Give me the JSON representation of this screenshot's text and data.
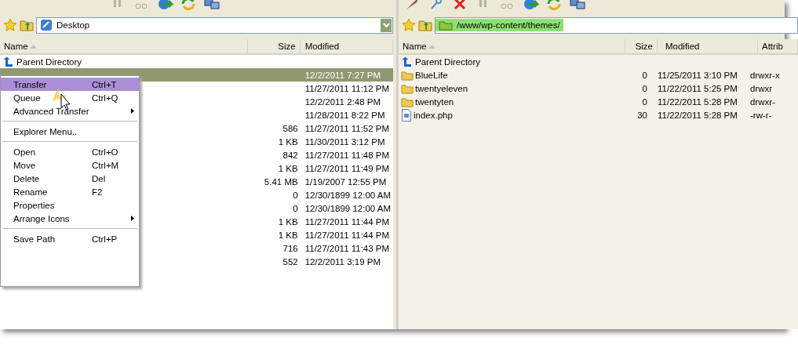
{
  "left_pane": {
    "path": "Desktop",
    "columns": [
      {
        "label": "Name",
        "sorted": true
      },
      {
        "label": "Size",
        "sorted": false
      },
      {
        "label": "Modified",
        "sorted": false
      }
    ],
    "rows": [
      {
        "kind": "parent",
        "name": "Parent Directory",
        "selected": false
      },
      {
        "kind": "hidden",
        "modified": "12/2/2011 7:27 PM",
        "selected": true
      },
      {
        "kind": "hidden",
        "modified": "11/27/2011 11:12 PM",
        "selected": false
      },
      {
        "kind": "hidden",
        "modified": "12/2/2011 2:48 PM",
        "selected": false
      },
      {
        "kind": "hidden",
        "modified": "11/28/2011 8:22 PM",
        "selected": false
      },
      {
        "kind": "hidden",
        "size": "586",
        "modified": "11/27/2011 11:52 PM",
        "selected": false
      },
      {
        "kind": "hidden",
        "size": "1 KB",
        "modified": "11/30/2011 3:12 PM",
        "selected": false
      },
      {
        "kind": "hidden",
        "size": "842",
        "modified": "11/27/2011 11:48 PM",
        "selected": false
      },
      {
        "kind": "hidden",
        "size": "1 KB",
        "modified": "11/27/2011 11:49 PM",
        "selected": false
      },
      {
        "kind": "hidden",
        "size": "5.41 MB",
        "modified": "1/19/2007 12:55 PM",
        "selected": false
      },
      {
        "kind": "hidden",
        "size": "0",
        "modified": "12/30/1899 12:00 AM",
        "selected": false
      },
      {
        "kind": "hidden",
        "size": "0",
        "modified": "12/30/1899 12:00 AM",
        "selected": false
      },
      {
        "kind": "hidden",
        "size": "1 KB",
        "modified": "11/27/2011 11:44 PM",
        "selected": false
      },
      {
        "kind": "hidden",
        "size": "1 KB",
        "modified": "11/27/2011 11:44 PM",
        "selected": false
      },
      {
        "kind": "hidden",
        "size": "716",
        "modified": "11/27/2011 11:43 PM",
        "selected": false
      },
      {
        "kind": "hidden",
        "size": "552",
        "modified": "12/2/2011 3:19 PM",
        "selected": false
      }
    ]
  },
  "context_menu": {
    "items": [
      {
        "kind": "item",
        "label": "Transfer",
        "shortcut": "Ctrl+T",
        "selected": true
      },
      {
        "kind": "item",
        "label": "Queue",
        "shortcut": "Ctrl+Q",
        "selected": false
      },
      {
        "kind": "submenu",
        "label": "Advanced Transfer",
        "selected": false
      },
      {
        "kind": "separator"
      },
      {
        "kind": "item",
        "label": "Explorer Menu..",
        "selected": false
      },
      {
        "kind": "separator"
      },
      {
        "kind": "item",
        "label": "Open",
        "shortcut": "Ctrl+O",
        "selected": false
      },
      {
        "kind": "item",
        "label": "Move",
        "shortcut": "Ctrl+M",
        "selected": false
      },
      {
        "kind": "item",
        "label": "Delete",
        "shortcut": "Del",
        "selected": false
      },
      {
        "kind": "item",
        "label": "Rename",
        "shortcut": "F2",
        "selected": false
      },
      {
        "kind": "item",
        "label": "Properties",
        "selected": false
      },
      {
        "kind": "submenu",
        "label": "Arrange Icons",
        "selected": false
      },
      {
        "kind": "separator"
      },
      {
        "kind": "item",
        "label": "Save Path",
        "shortcut": "Ctrl+P",
        "selected": false
      }
    ]
  },
  "right_pane": {
    "path": "/www/wp-content/themes/",
    "columns": [
      {
        "label": "Name",
        "sorted": true
      },
      {
        "label": "Size",
        "sorted": false
      },
      {
        "label": "Modified",
        "sorted": false
      },
      {
        "label": "Attrib",
        "sorted": false
      }
    ],
    "rows": [
      {
        "kind": "parent",
        "name": "Parent Directory",
        "selected": false
      },
      {
        "kind": "folder",
        "name": "BlueLife",
        "size": "0",
        "modified": "11/25/2011 3:10 PM",
        "attrib": "drwxr-x",
        "selected": false
      },
      {
        "kind": "folder",
        "name": "twentyeleven",
        "size": "0",
        "modified": "11/22/2011 5:25 PM",
        "attrib": "drwxr",
        "selected": false
      },
      {
        "kind": "folder",
        "name": "twentyten",
        "size": "0",
        "modified": "11/22/2011 5:28 PM",
        "attrib": "drwxr-",
        "selected": false
      },
      {
        "kind": "file",
        "name": "index.php",
        "size": "30",
        "modified": "11/22/2011 5:28 PM",
        "attrib": "-rw-r-",
        "selected": false
      }
    ]
  }
}
